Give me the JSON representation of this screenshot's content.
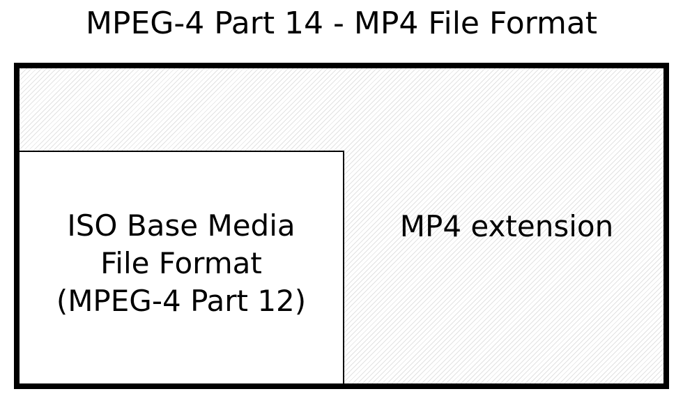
{
  "title": "MPEG-4 Part 14 - MP4 File Format",
  "inner_box": {
    "lines": [
      "ISO Base Media",
      "File Format",
      "(MPEG-4 Part 12)"
    ]
  },
  "extension_label": "MP4 extension"
}
